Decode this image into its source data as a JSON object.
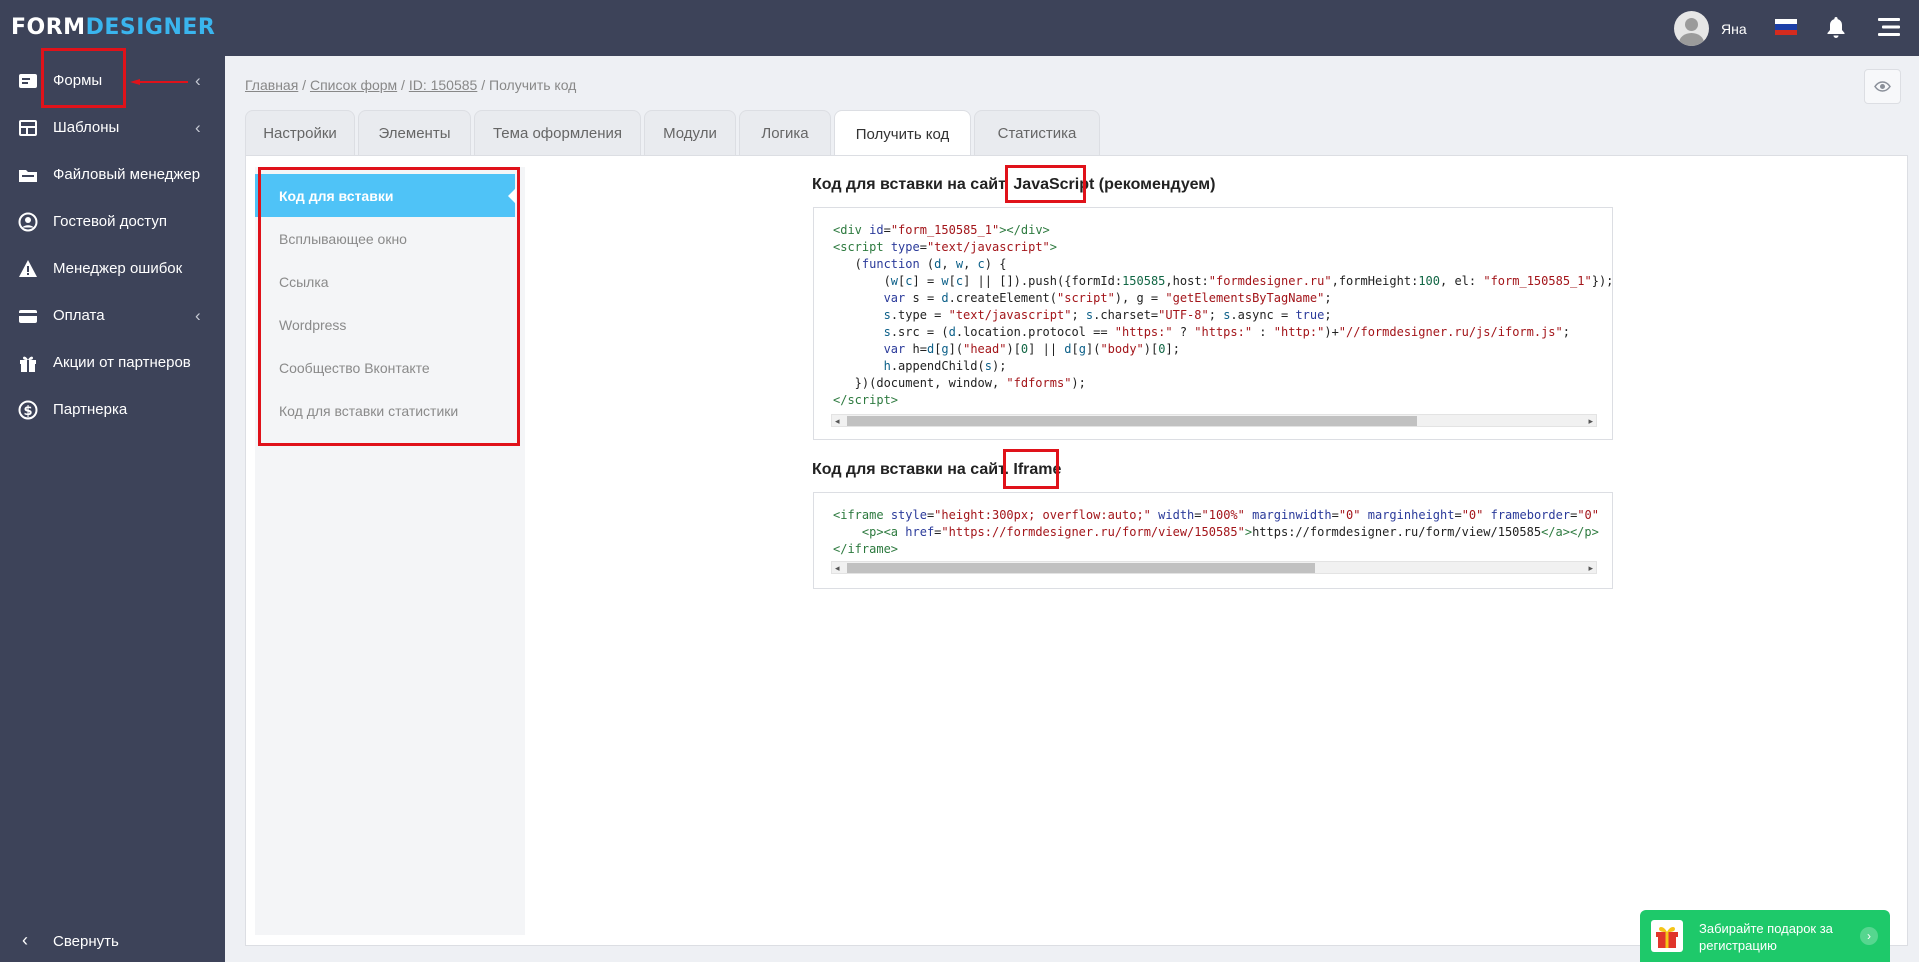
{
  "app": {
    "logo_part1": "FORM",
    "logo_part2": "DESIGNER"
  },
  "header": {
    "user_name": "Яна",
    "flag": "ru",
    "flag_colors": [
      "#ffffff",
      "#1c3fa8",
      "#d52b1e"
    ],
    "bell_icon": "bell-icon",
    "menu_icon": "hamburger-icon"
  },
  "sidebar": {
    "items": [
      {
        "label": "Формы",
        "icon": "form-icon",
        "has_chevron": true
      },
      {
        "label": "Шаблоны",
        "icon": "template-icon",
        "has_chevron": true
      },
      {
        "label": "Файловый менеджер",
        "icon": "folder-icon",
        "has_chevron": false
      },
      {
        "label": "Гостевой доступ",
        "icon": "user-circle-icon",
        "has_chevron": false
      },
      {
        "label": "Менеджер ошибок",
        "icon": "warning-icon",
        "has_chevron": false
      },
      {
        "label": "Оплата",
        "icon": "card-icon",
        "has_chevron": true
      },
      {
        "label": "Акции от партнеров",
        "icon": "gift-icon",
        "has_chevron": false
      },
      {
        "label": "Партнерка",
        "icon": "dollar-icon",
        "has_chevron": false
      }
    ],
    "collapse_label": "Свернуть"
  },
  "breadcrumb": {
    "home": "Главная",
    "sep1": " / ",
    "forms_list": "Список форм",
    "sep2": " / ",
    "form_id": "ID: 150585",
    "sep3": " / ",
    "current": "Получить код"
  },
  "tabs": [
    {
      "label": "Настройки",
      "active": false
    },
    {
      "label": "Элементы",
      "active": false
    },
    {
      "label": "Тема оформления",
      "active": false
    },
    {
      "label": "Модули",
      "active": false
    },
    {
      "label": "Логика",
      "active": false
    },
    {
      "label": "Получить код",
      "active": true
    },
    {
      "label": "Статистика",
      "active": false
    }
  ],
  "subnav": [
    {
      "label": "Код для вставки",
      "active": true
    },
    {
      "label": "Всплывающее окно",
      "active": false
    },
    {
      "label": "Ссылка",
      "active": false
    },
    {
      "label": "Wordpress",
      "active": false
    },
    {
      "label": "Сообщество Вконтакте",
      "active": false
    },
    {
      "label": "Код для вставки статистики",
      "active": false
    }
  ],
  "js_section": {
    "title_prefix": "Код для вставки на сайт. ",
    "title_highlight": "JavaScript",
    "title_suffix": " (рекомендуем)"
  },
  "iframe_section": {
    "title_prefix": "Код для вставки на сайт. ",
    "title_highlight": "Iframe"
  },
  "gift_banner": {
    "text": "Забирайте подарок за регистрацию"
  },
  "colors": {
    "sidebar_bg": "#3d4359",
    "accent": "#4fc3f7",
    "highlight_red": "#e0121a",
    "gift_green": "#1ec96a"
  }
}
